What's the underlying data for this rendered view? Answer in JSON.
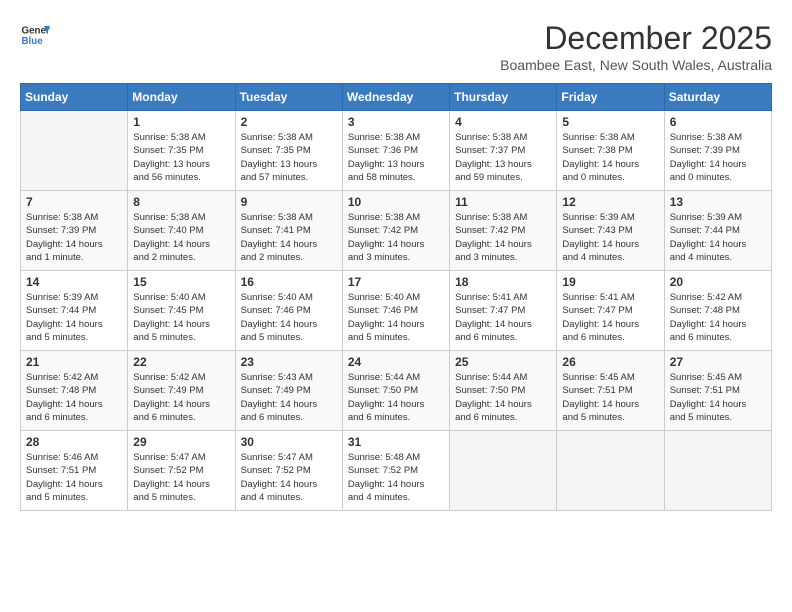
{
  "header": {
    "logo_general": "General",
    "logo_blue": "Blue",
    "month_title": "December 2025",
    "subtitle": "Boambee East, New South Wales, Australia"
  },
  "days_header": [
    "Sunday",
    "Monday",
    "Tuesday",
    "Wednesday",
    "Thursday",
    "Friday",
    "Saturday"
  ],
  "weeks": [
    [
      {
        "day": "",
        "content": ""
      },
      {
        "day": "1",
        "content": "Sunrise: 5:38 AM\nSunset: 7:35 PM\nDaylight: 13 hours\nand 56 minutes."
      },
      {
        "day": "2",
        "content": "Sunrise: 5:38 AM\nSunset: 7:35 PM\nDaylight: 13 hours\nand 57 minutes."
      },
      {
        "day": "3",
        "content": "Sunrise: 5:38 AM\nSunset: 7:36 PM\nDaylight: 13 hours\nand 58 minutes."
      },
      {
        "day": "4",
        "content": "Sunrise: 5:38 AM\nSunset: 7:37 PM\nDaylight: 13 hours\nand 59 minutes."
      },
      {
        "day": "5",
        "content": "Sunrise: 5:38 AM\nSunset: 7:38 PM\nDaylight: 14 hours\nand 0 minutes."
      },
      {
        "day": "6",
        "content": "Sunrise: 5:38 AM\nSunset: 7:39 PM\nDaylight: 14 hours\nand 0 minutes."
      }
    ],
    [
      {
        "day": "7",
        "content": "Sunrise: 5:38 AM\nSunset: 7:39 PM\nDaylight: 14 hours\nand 1 minute."
      },
      {
        "day": "8",
        "content": "Sunrise: 5:38 AM\nSunset: 7:40 PM\nDaylight: 14 hours\nand 2 minutes."
      },
      {
        "day": "9",
        "content": "Sunrise: 5:38 AM\nSunset: 7:41 PM\nDaylight: 14 hours\nand 2 minutes."
      },
      {
        "day": "10",
        "content": "Sunrise: 5:38 AM\nSunset: 7:42 PM\nDaylight: 14 hours\nand 3 minutes."
      },
      {
        "day": "11",
        "content": "Sunrise: 5:38 AM\nSunset: 7:42 PM\nDaylight: 14 hours\nand 3 minutes."
      },
      {
        "day": "12",
        "content": "Sunrise: 5:39 AM\nSunset: 7:43 PM\nDaylight: 14 hours\nand 4 minutes."
      },
      {
        "day": "13",
        "content": "Sunrise: 5:39 AM\nSunset: 7:44 PM\nDaylight: 14 hours\nand 4 minutes."
      }
    ],
    [
      {
        "day": "14",
        "content": "Sunrise: 5:39 AM\nSunset: 7:44 PM\nDaylight: 14 hours\nand 5 minutes."
      },
      {
        "day": "15",
        "content": "Sunrise: 5:40 AM\nSunset: 7:45 PM\nDaylight: 14 hours\nand 5 minutes."
      },
      {
        "day": "16",
        "content": "Sunrise: 5:40 AM\nSunset: 7:46 PM\nDaylight: 14 hours\nand 5 minutes."
      },
      {
        "day": "17",
        "content": "Sunrise: 5:40 AM\nSunset: 7:46 PM\nDaylight: 14 hours\nand 5 minutes."
      },
      {
        "day": "18",
        "content": "Sunrise: 5:41 AM\nSunset: 7:47 PM\nDaylight: 14 hours\nand 6 minutes."
      },
      {
        "day": "19",
        "content": "Sunrise: 5:41 AM\nSunset: 7:47 PM\nDaylight: 14 hours\nand 6 minutes."
      },
      {
        "day": "20",
        "content": "Sunrise: 5:42 AM\nSunset: 7:48 PM\nDaylight: 14 hours\nand 6 minutes."
      }
    ],
    [
      {
        "day": "21",
        "content": "Sunrise: 5:42 AM\nSunset: 7:48 PM\nDaylight: 14 hours\nand 6 minutes."
      },
      {
        "day": "22",
        "content": "Sunrise: 5:42 AM\nSunset: 7:49 PM\nDaylight: 14 hours\nand 6 minutes."
      },
      {
        "day": "23",
        "content": "Sunrise: 5:43 AM\nSunset: 7:49 PM\nDaylight: 14 hours\nand 6 minutes."
      },
      {
        "day": "24",
        "content": "Sunrise: 5:44 AM\nSunset: 7:50 PM\nDaylight: 14 hours\nand 6 minutes."
      },
      {
        "day": "25",
        "content": "Sunrise: 5:44 AM\nSunset: 7:50 PM\nDaylight: 14 hours\nand 6 minutes."
      },
      {
        "day": "26",
        "content": "Sunrise: 5:45 AM\nSunset: 7:51 PM\nDaylight: 14 hours\nand 5 minutes."
      },
      {
        "day": "27",
        "content": "Sunrise: 5:45 AM\nSunset: 7:51 PM\nDaylight: 14 hours\nand 5 minutes."
      }
    ],
    [
      {
        "day": "28",
        "content": "Sunrise: 5:46 AM\nSunset: 7:51 PM\nDaylight: 14 hours\nand 5 minutes."
      },
      {
        "day": "29",
        "content": "Sunrise: 5:47 AM\nSunset: 7:52 PM\nDaylight: 14 hours\nand 5 minutes."
      },
      {
        "day": "30",
        "content": "Sunrise: 5:47 AM\nSunset: 7:52 PM\nDaylight: 14 hours\nand 4 minutes."
      },
      {
        "day": "31",
        "content": "Sunrise: 5:48 AM\nSunset: 7:52 PM\nDaylight: 14 hours\nand 4 minutes."
      },
      {
        "day": "",
        "content": ""
      },
      {
        "day": "",
        "content": ""
      },
      {
        "day": "",
        "content": ""
      }
    ]
  ]
}
